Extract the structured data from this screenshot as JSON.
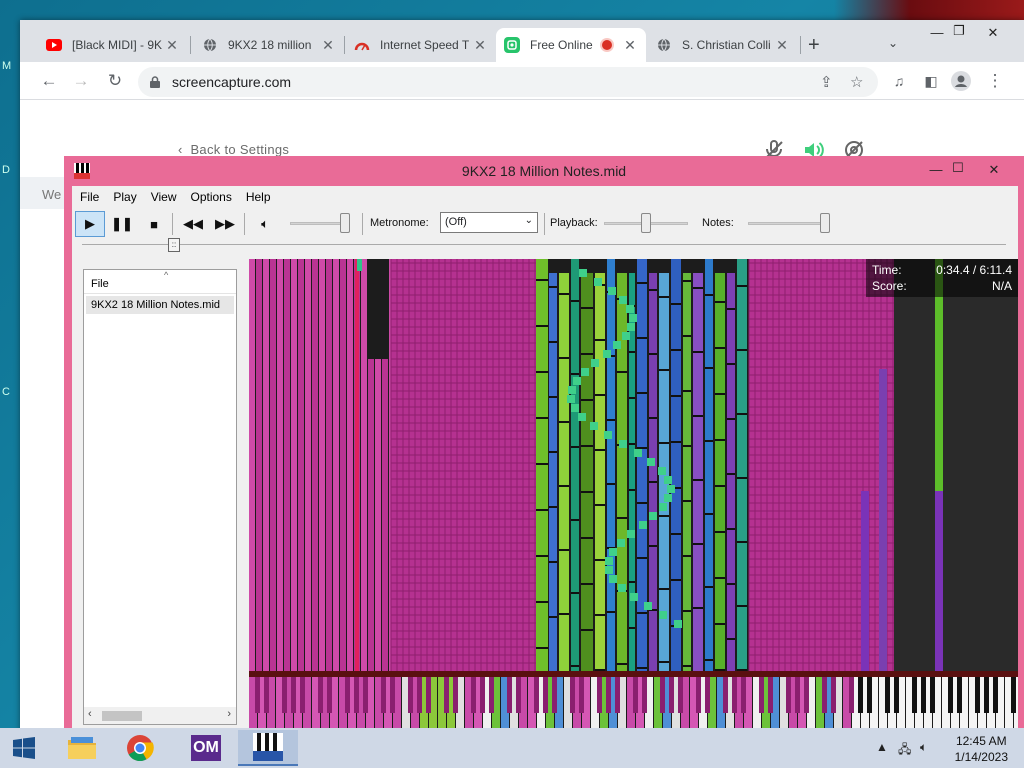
{
  "browser": {
    "tabs": [
      {
        "label": "[Black MIDI] - 9K",
        "icon": "youtube-icon"
      },
      {
        "label": "9KX2 18 million",
        "icon": "globe-icon"
      },
      {
        "label": "Internet Speed T",
        "icon": "speedometer-icon"
      },
      {
        "label": "Free Online",
        "icon": "screen-capture-icon",
        "active": true,
        "recording": true
      },
      {
        "label": "S. Christian Colli",
        "icon": "globe-icon"
      }
    ],
    "url": "screencapture.com"
  },
  "page": {
    "back_link": "Back to Settings",
    "side_text": "We"
  },
  "midi_window": {
    "title": "9KX2 18 Million Notes.mid",
    "menu": [
      "File",
      "Play",
      "View",
      "Options",
      "Help"
    ],
    "metronome_label": "Metronome:",
    "metronome_value": "(Off)",
    "playback_label": "Playback:",
    "notes_label": "Notes:",
    "seek_thumb": "::",
    "file_panel": {
      "header": "File",
      "files": [
        "9KX2 18 Million Notes.mid"
      ]
    },
    "time_label": "Time:",
    "time_value": "0:34.4 / 6:11.4",
    "score_label": "Score:",
    "score_value": "N/A",
    "accent_color": "#e96b97"
  },
  "taskbar": {
    "apps": [
      "file-explorer-icon",
      "chrome-icon",
      "omnimidi-icon",
      "piano-from-above-icon"
    ],
    "om_label": "OM",
    "clock_time": "12:45 AM",
    "clock_date": "1/14/2023"
  }
}
